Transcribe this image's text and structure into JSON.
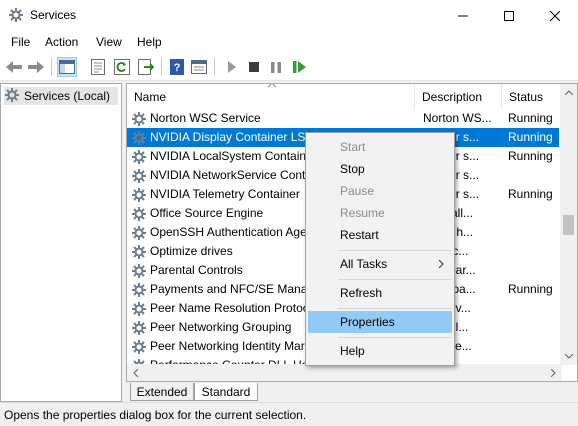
{
  "window": {
    "title": "Services"
  },
  "menubar": [
    "File",
    "Action",
    "View",
    "Help"
  ],
  "tree": {
    "root_label": "Services (Local)"
  },
  "columns": {
    "name": "Name",
    "description": "Description",
    "status": "Status"
  },
  "rows": [
    {
      "name": "Norton WSC Service",
      "description": "Norton WS...",
      "status": "Running"
    },
    {
      "name": "NVIDIA Display Container LS",
      "description": "ntainer s...",
      "status": "Running",
      "selected": true
    },
    {
      "name": "NVIDIA LocalSystem Containe",
      "description": "ntainer s...",
      "status": "Running"
    },
    {
      "name": "NVIDIA NetworkService Conta",
      "description": "ntainer s...",
      "status": ""
    },
    {
      "name": "NVIDIA Telemetry Container",
      "description": "ntainer s...",
      "status": "Running"
    },
    {
      "name": "Office  Source Engine",
      "description": "s install...",
      "status": ""
    },
    {
      "name": "OpenSSH Authentication Age",
      "description": "ent to h...",
      "status": ""
    },
    {
      "name": "Optimize drives",
      "description": "s the c...",
      "status": ""
    },
    {
      "name": "Parental Controls",
      "description": "rces par...",
      "status": ""
    },
    {
      "name": "Payments and NFC/SE Manag",
      "description": "ages pa...",
      "status": "Running"
    },
    {
      "name": "Peer Name Resolution Protoc",
      "description": "es serv...",
      "status": ""
    },
    {
      "name": "Peer Networking Grouping",
      "description": "es mul...",
      "status": ""
    },
    {
      "name": "Peer Networking Identity Mar",
      "description": "des ide...",
      "status": ""
    },
    {
      "name": "Performance Counter DLL Ho",
      "description": "",
      "status": ""
    }
  ],
  "context_menu": {
    "start": "Start",
    "stop": "Stop",
    "pause": "Pause",
    "resume": "Resume",
    "restart": "Restart",
    "all_tasks": "All Tasks",
    "refresh": "Refresh",
    "properties": "Properties",
    "help": "Help"
  },
  "tabs": {
    "extended": "Extended",
    "standard": "Standard"
  },
  "statusbar": {
    "text": "Opens the properties dialog box for the current selection."
  },
  "colors": {
    "selection": "#0078d7",
    "menu_highlight": "#91c9f7",
    "play_green": "#3a9a3a"
  }
}
